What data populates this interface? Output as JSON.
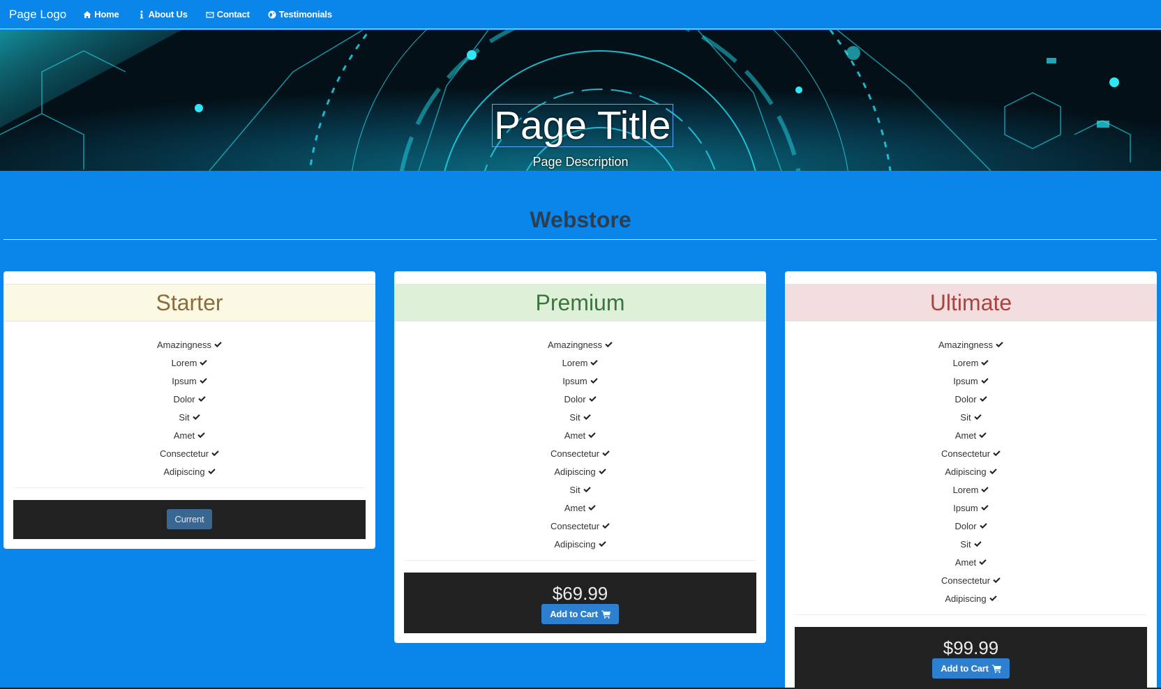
{
  "nav": {
    "logo": "Page Logo",
    "items": [
      {
        "label": "Home",
        "icon": "home-icon"
      },
      {
        "label": "About Us",
        "icon": "info-icon"
      },
      {
        "label": "Contact",
        "icon": "envelope-icon"
      },
      {
        "label": "Testimonials",
        "icon": "globe-icon"
      }
    ]
  },
  "hero": {
    "title": "Page Title",
    "description": "Page Description"
  },
  "section": {
    "title": "Webstore"
  },
  "plans": [
    {
      "name": "Starter",
      "header_bg": "#fbf8e4",
      "header_color": "#8a6d3b",
      "features": [
        "Amazingness",
        "Lorem",
        "Ipsum",
        "Dolor",
        "Sit",
        "Amet",
        "Consectetur",
        "Adipiscing"
      ],
      "button": "Current"
    },
    {
      "name": "Premium",
      "header_bg": "#dff0d8",
      "header_color": "#3c763d",
      "features": [
        "Amazingness",
        "Lorem",
        "Ipsum",
        "Dolor",
        "Sit",
        "Amet",
        "Consectetur",
        "Adipiscing",
        "Sit",
        "Amet",
        "Consectetur",
        "Adipiscing"
      ],
      "price": "$69.99",
      "button": "Add to Cart"
    },
    {
      "name": "Ultimate",
      "header_bg": "#f2dede",
      "header_color": "#a94442",
      "features": [
        "Amazingness",
        "Lorem",
        "Ipsum",
        "Dolor",
        "Sit",
        "Amet",
        "Consectetur",
        "Adipiscing",
        "Lorem",
        "Ipsum",
        "Dolor",
        "Sit",
        "Amet",
        "Consectetur",
        "Adipiscing"
      ],
      "price": "$99.99",
      "button": "Add to Cart"
    }
  ],
  "colors": {
    "page_bg": "#0a85ea",
    "footer_bg": "#212121",
    "button": "#2d7fd0"
  }
}
